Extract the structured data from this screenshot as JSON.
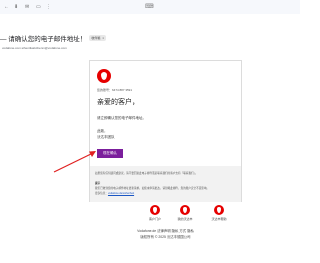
{
  "toolbar": {
    "icons": [
      "back-icon",
      "archive-icon",
      "mail-icon",
      "folder-icon",
      "more-icon"
    ],
    "more_glyph": "⋮"
  },
  "email": {
    "subject": "— 请确认您的电子邮件地址！",
    "label": "收件箱",
    "label_close": "×",
    "sender_line": "vodafone.com.sthentikaitvibenm@vodafone.com",
    "account_meta": "您的账号：6474 887 3591",
    "greeting": "亲爱的客户，",
    "body_line_1": "请立即确认您的电子邮件地址。",
    "body_line_2": "此致，",
    "body_line_3": "沃达丰团队",
    "confirm_button": "现在确认",
    "footer_note_1": "如果您有任何疑问或建议，请不要回复此电子邮件而是联系我们的客户支持「联系我们」。",
    "footer_heading": "提示",
    "footer_note_2": "我们已收到您的电子邮件地址更新请求。如您未申请更改，请忽略此邮件，您的账户安全不受影响。",
    "footer_note_3_prefix": "更多信息：",
    "footer_link": "vodafone.de/sicherheit"
  },
  "apps": [
    {
      "label": "客户门户",
      "icon": "vodafone-logo-icon"
    },
    {
      "label": "我的沃达丰",
      "icon": "vodafone-logo-icon"
    },
    {
      "label": "沃达丰帮助",
      "icon": "vodafone-logo-icon"
    }
  ],
  "footer": {
    "links": "Vodafone.de 法律声明 隐私 方式 隐私",
    "copyright": "版权所有 © 2025 沃达丰德国公司"
  },
  "colors": {
    "brand_red": "#e60000",
    "button_purple": "#7b1e9c",
    "arrow_red": "#e02020"
  }
}
